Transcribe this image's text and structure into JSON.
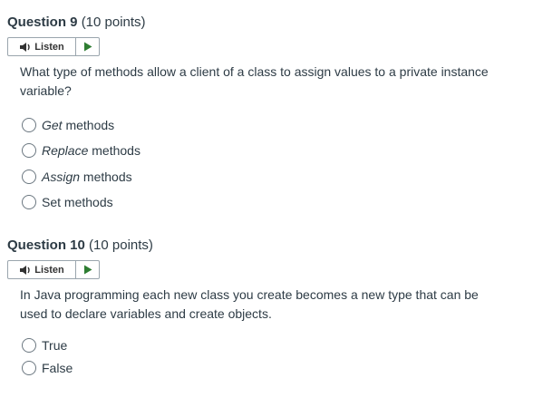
{
  "questions": [
    {
      "title": "Question 9",
      "points": "(10 points)",
      "listen_label": "Listen",
      "text": "What type of methods allow a client of a class to assign values to a private instance variable?",
      "options": [
        {
          "em": "Get",
          "rest": " methods"
        },
        {
          "em": "Replace",
          "rest": " methods"
        },
        {
          "em": "Assign",
          "rest": " methods"
        },
        {
          "em": "",
          "rest": "Set methods"
        }
      ]
    },
    {
      "title": "Question 10",
      "points": "(10 points)",
      "listen_label": "Listen",
      "text": "In Java programming each new class you create becomes a new type that can be used to declare variables and create objects.",
      "options": [
        {
          "em": "",
          "rest": "True"
        },
        {
          "em": "",
          "rest": "False"
        }
      ]
    }
  ],
  "icons": {
    "speaker": "speaker-icon",
    "play": "play-icon"
  },
  "colors": {
    "play": "#2e7d32",
    "text": "#2d3b45"
  }
}
